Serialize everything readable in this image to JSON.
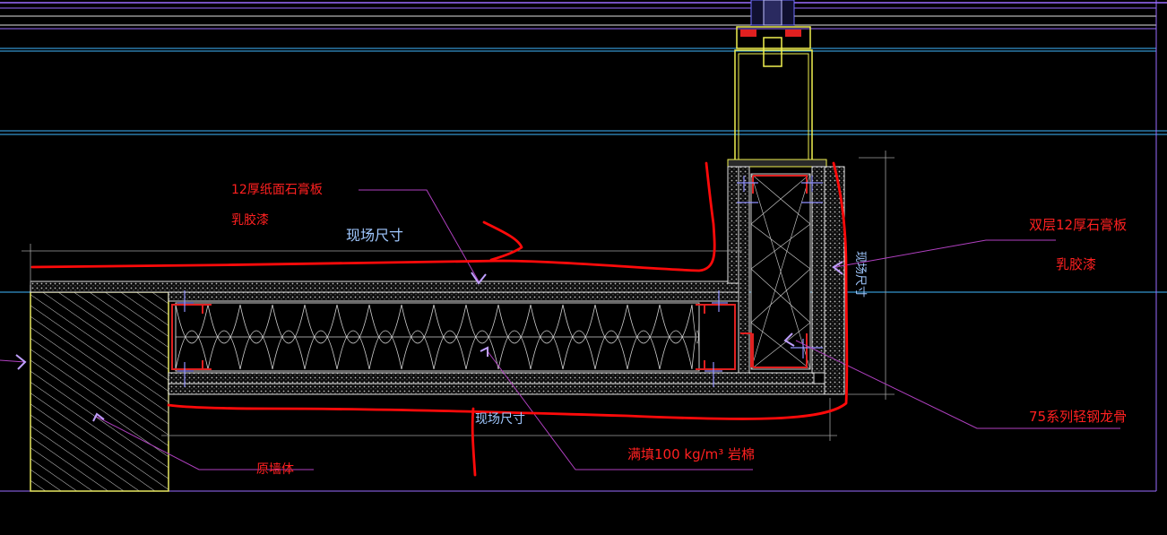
{
  "colors": {
    "background": "#000000",
    "annotation_red": "#ff2020",
    "markup_red": "#ff0a0a",
    "dimension_blue": "#a0c8ff",
    "leader_magenta": "#b040c0",
    "grid_purple": "#9a6cff",
    "grid_cyan": "#3fb8ff",
    "wall_yellow": "#e8e860",
    "frame_yellow": "#f0f050"
  },
  "labels": {
    "gypsum_12": "12厚纸面石膏板",
    "latex_paint_left": "乳胶漆",
    "site_size_top": "现场尺寸",
    "site_size_bottom": "现场尺寸",
    "double_gypsum": "双层12厚石膏板",
    "latex_paint_right": "乳胶漆",
    "keel_75": "75系列轻钢龙骨",
    "rock_wool": "满填100 kg/m³ 岩棉",
    "original_wall": "原墙体",
    "site_size_vertical": "现场尺寸"
  }
}
